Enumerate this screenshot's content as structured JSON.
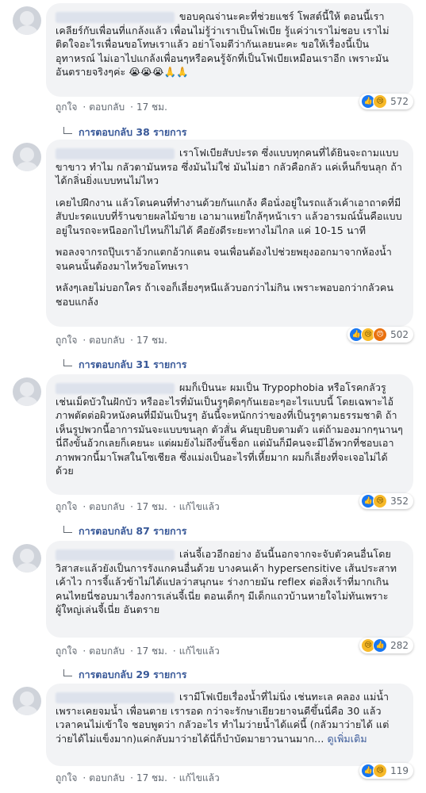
{
  "comments": [
    {
      "paragraphs": [
        "ขอบคุณจ่านะคะที่ช่วยแชร์ โพสต์นี้ให้ ตอนนี้เราเคลียร์กับเพื่อนที่แกล้งแล้ว เพื่อนไม่รู้ว่าเราเป็นโฟเบีย รู้แค่ว่าเราไม่ชอบ เราไม่ติดใจอะไรเพื่อนขอโทษเราแล้ว อย่าโจมตีว่ากันเลยนะคะ ขอให้เรื่องนี้เป็นอุทาหรณ์ ไม่เอาไปแกล้งเพื่อนๆหรือคนรู้จักที่เป็นโฟเบียเหมือนเราอีก เพราะมันอันตรายจริงๆค่ะ 😭😭😭🙏🙏"
      ],
      "like": "ถูกใจ",
      "reply": "ตอบกลับ",
      "time": "17 ชม.",
      "edited": "",
      "reaction_count": "572",
      "reaction_icons": [
        "like-icon",
        "sad-icon"
      ],
      "replies_label": "การตอบกลับ 38 รายการ"
    },
    {
      "paragraphs": [
        "เราโฟเบียสับปะรด ซึ่งแบบทุกคนที่ได้ยินจะถามแบบขาขาว ทำไม กลัวตามันหรอ ซึ่งมันไม่ใช่ มันไม่ฮา กลัวคือกลัว แค่เห็นก็ขนลุก ถ้าได้กลิ่นยิ่งแบบทนไม่ไหว",
        "เคยไปฝึกงาน แล้วโดนคนที่ทำงานด้วยกันแกล้ง คือนั่งอยู่ในรถแล้วเค้าเอาถาดที่มีสับปะรดแบบที่ร้านขายผลไม้ขาย เอามาแหย่ใกล้ๆหน้าเรา แล้วอารมณ์นั้นคือแบบอยู่ในรถจะหนีออกไปไหนก็ไม่ได้ คือยังดีระยะทางไม่ไกล แค่ 10-15 นาที",
        "พอลงจากรถปุ๊บเราอ้วกแตกอ้วกแตน จนเพื่อนต้องไปช่วยพยุงออกมาจากห้องน้ำ จนคนนั้นต้องมาไหว้ขอโทษเรา",
        "หลังๆเลยไม่บอกใคร ถ้าเจอก็เลี่ยงๆหนีแล้วบอกว่าไม่กิน เพราะพอบอกว่ากลัวคนชอบแกล้ง"
      ],
      "like": "ถูกใจ",
      "reply": "ตอบกลับ",
      "time": "17 ชม.",
      "edited": "",
      "reaction_count": "502",
      "reaction_icons": [
        "like-icon",
        "sad-icon",
        "angry-icon"
      ],
      "replies_label": "การตอบกลับ 31 รายการ"
    },
    {
      "paragraphs": [
        "ผมก็เป็นนะ ผมเป็น Trypophobia หรือโรคกลัวรู เช่นเม็ดบัวในฝักบัว หรืออะไรที่มันเป็นรูๆติดๆกันเยอะๆอะไรแบบนี้ โดยเฉพาะไอ้ภาพตัดต่อผิวหนังคนที่มีมันเป็นรูๆ อันนี้จะหนักกว่าของที่เป็นรูๆตามธรรมชาติ ถ้าเห็นรูปพวกนี้อาการมันจะแบบขนลุก ตัวสั่น คันยุบยิบตามตัว แต่ถ้ามองมากๆนานๆนี่ถึงขั้นอ้วกเลยก็เคยนะ แต่ผมยังไม่ถึงขั้นช็อก แต่มันก็มีคนจะมีไอ้พวกที่ชอบเอาภาพพวกนี้มาโพสในโซเชียล ซึ่งแม่งเป็นอะไรที่เหี้ยมาก ผมก็เลี่ยงที่จะเจอไม่ได้ด้วย"
      ],
      "like": "ถูกใจ",
      "reply": "ตอบกลับ",
      "time": "17 ชม.",
      "edited": "แก้ไขแล้ว",
      "reaction_count": "352",
      "reaction_icons": [
        "like-icon",
        "sad-icon"
      ],
      "replies_label": "การตอบกลับ 87 รายการ"
    },
    {
      "paragraphs": [
        "เล่นจี้เอวอีกอย่าง อันนี้นอกจากจะจับตัวคนอื่นโดยวิสาสะแล้วยังเป็นการรังแกคนอื่นด้วย บางคนเค้า hypersensitive เส้นประสาทเค้าไว การจี้แล้วข้าไม่ได้แปลว่าสนุกนะ ร่างกายมัน reflex ต่อสิ่งเร้าที่มากเกิน คนไทยนี่ชอบมาเรื่องการเล่นจี้เนี่ย ตอนเด็กๆ มีเด็กแถวบ้านหายใจไม่ทันเพราะ ผู้ใหญ่เล่นจี้เนี่ย อันตราย"
      ],
      "like": "ถูกใจ",
      "reply": "ตอบกลับ",
      "time": "17 ชม.",
      "edited": "แก้ไขแล้ว",
      "reaction_count": "282",
      "reaction_icons": [
        "sad-icon",
        "like-icon"
      ],
      "replies_label": "การตอบกลับ 29 รายการ"
    },
    {
      "paragraphs": [
        "เรามีโฟเบียเรื่องน้ำที่ไม่นิ่ง เช่นทะเล คลอง แม่น้ำเพราะเคยจมน้ำ เพื่อนตาย เรารอด กว่าจะรักษาเยียวยาจนดีขึ้นนี่คือ 30 แล้ว เวลาคนไม่เข้าใจ ชอบพูดว่า กลัวอะไร ทำไมว่ายน้ำได้แค่นี้ (กลัวมาว่ายได้ แต่ว่ายได้ไม่แข็งมาก)แค่กลับมาว่ายได้นี่ก็บำบัดมายาวนานมาก..."
      ],
      "see_more": "ดูเพิ่มเติม",
      "like": "ถูกใจ",
      "reply": "ตอบกลับ",
      "time": "17 ชม.",
      "edited": "แก้ไขแล้ว",
      "reaction_count": "119",
      "reaction_icons": [
        "like-icon",
        "sad-icon"
      ]
    }
  ],
  "separator": "·",
  "colors": {
    "bubble": "#f2f3f5",
    "link": "#385898",
    "meta": "#606770",
    "like": "#1877f2",
    "sad": "#f7b928",
    "angry": "#e9710f"
  }
}
